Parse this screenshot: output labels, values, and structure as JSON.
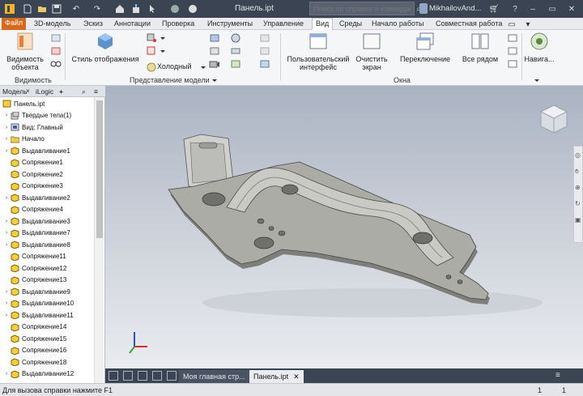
{
  "window": {
    "title": "Панель.ipt",
    "help_search_placeholder": "Поиск по справке и командам",
    "user": "MikhailovAnd..."
  },
  "menu_tabs": [
    "Файл",
    "3D-модель",
    "Эскиз",
    "Аннотации",
    "Проверка",
    "Инструменты",
    "Управление",
    "Вид",
    "Среды",
    "Начало работы",
    "Совместная работа"
  ],
  "ribbon": {
    "visibility_button": "Видимость объекта",
    "visibility_group": "Видимость",
    "display_style_button": "Стиль отображения",
    "visual_style_value": "Холодный",
    "model_view_group": "Представление модели",
    "user_interface_button": "Пользовательский интерфейс",
    "clean_screen_button": "Очистить экран",
    "switch_button": "Переключение",
    "arrange_button": "Все рядом",
    "window_group": "Окна",
    "navigation_button": "Навига..."
  },
  "browser": {
    "tab_model": "Модель",
    "tab_ilogic": "iLogic",
    "tab_add": "+",
    "items": [
      {
        "label": "Панель.ipt",
        "type": "part",
        "level": 0,
        "twisty": false
      },
      {
        "label": "Твердые тела(1)",
        "type": "solids",
        "level": 1,
        "twisty": true
      },
      {
        "label": "Вид: Главный",
        "type": "view",
        "level": 1,
        "twisty": true
      },
      {
        "label": "Начало",
        "type": "folder",
        "level": 1,
        "twisty": true
      },
      {
        "label": "Выдавливание1",
        "type": "feature",
        "level": 1,
        "twisty": true
      },
      {
        "label": "Сопряжение1",
        "type": "feature",
        "level": 1,
        "twisty": false
      },
      {
        "label": "Сопряжение2",
        "type": "feature",
        "level": 1,
        "twisty": false
      },
      {
        "label": "Сопряжение3",
        "type": "feature",
        "level": 1,
        "twisty": false
      },
      {
        "label": "Выдавливание2",
        "type": "feature",
        "level": 1,
        "twisty": true
      },
      {
        "label": "Сопряжение4",
        "type": "feature",
        "level": 1,
        "twisty": false
      },
      {
        "label": "Выдавливание3",
        "type": "feature",
        "level": 1,
        "twisty": true
      },
      {
        "label": "Выдавливание7",
        "type": "feature",
        "level": 1,
        "twisty": true
      },
      {
        "label": "Выдавливание8",
        "type": "feature",
        "level": 1,
        "twisty": true
      },
      {
        "label": "Сопряжение11",
        "type": "feature",
        "level": 1,
        "twisty": false
      },
      {
        "label": "Сопряжение12",
        "type": "feature",
        "level": 1,
        "twisty": false
      },
      {
        "label": "Сопряжение13",
        "type": "feature",
        "level": 1,
        "twisty": false
      },
      {
        "label": "Выдавливание9",
        "type": "feature",
        "level": 1,
        "twisty": true
      },
      {
        "label": "Выдавливание10",
        "type": "feature",
        "level": 1,
        "twisty": true
      },
      {
        "label": "Выдавливание11",
        "type": "feature",
        "level": 1,
        "twisty": true
      },
      {
        "label": "Сопряжение14",
        "type": "feature",
        "level": 1,
        "twisty": false
      },
      {
        "label": "Сопряжение15",
        "type": "feature",
        "level": 1,
        "twisty": false
      },
      {
        "label": "Сопряжение16",
        "type": "feature",
        "level": 1,
        "twisty": false
      },
      {
        "label": "Сопряжение18",
        "type": "feature",
        "level": 1,
        "twisty": false
      },
      {
        "label": "Выдавливание12",
        "type": "feature",
        "level": 1,
        "twisty": true
      }
    ]
  },
  "doc_tabs": [
    {
      "label": "Моя главная стр...",
      "active": false
    },
    {
      "label": "Панель.ipt",
      "active": true
    }
  ],
  "status": {
    "help_text": "Для вызова справки нажмите F1",
    "num1": "1",
    "num2": "1"
  },
  "colors": {
    "titlebar": "#3b4453",
    "file_tab": "#d9671c",
    "part_gray": "#a7a7a2",
    "feature_yellow": "#f3cf3a"
  }
}
